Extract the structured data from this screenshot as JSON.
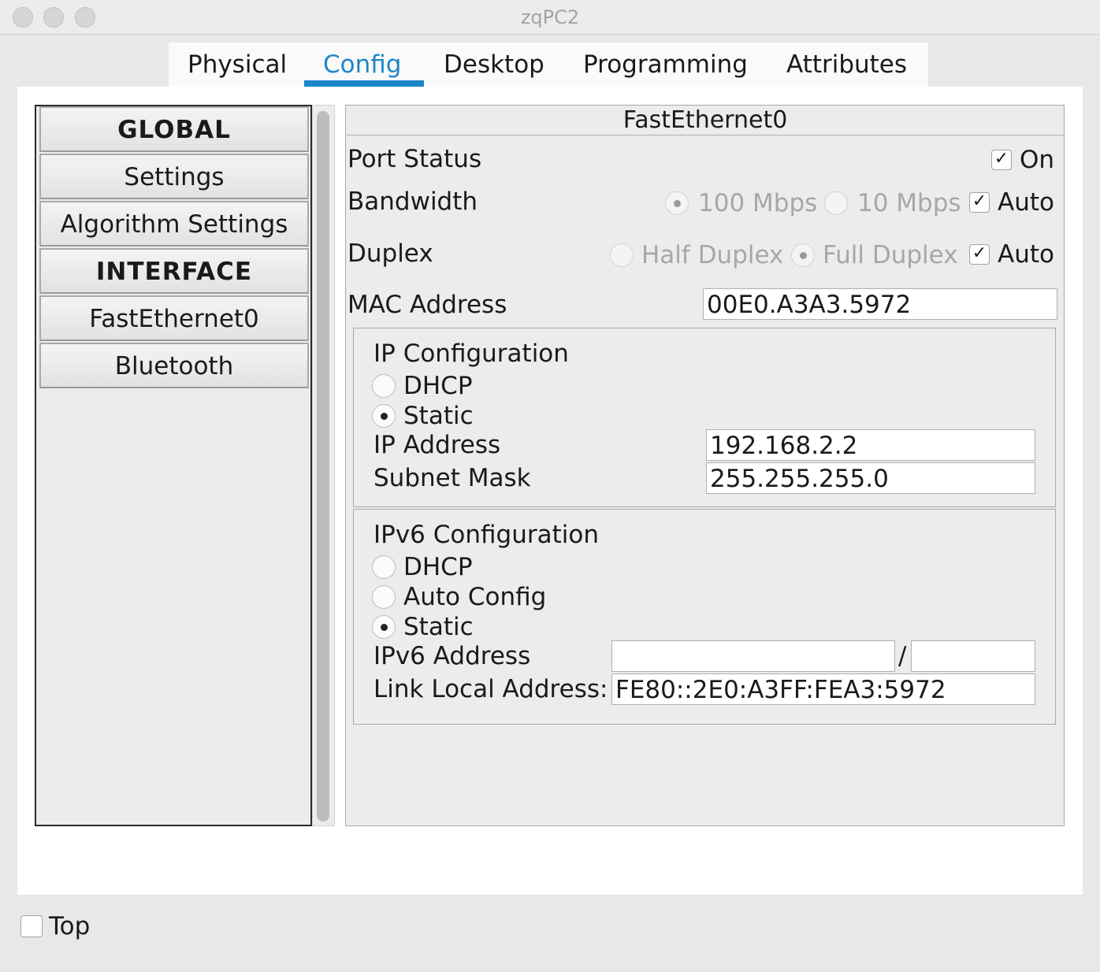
{
  "window": {
    "title": "zqPC2"
  },
  "tabs": [
    "Physical",
    "Config",
    "Desktop",
    "Programming",
    "Attributes"
  ],
  "active_tab": "Config",
  "sidebar": {
    "items": [
      {
        "label": "GLOBAL",
        "type": "header"
      },
      {
        "label": "Settings",
        "type": "item"
      },
      {
        "label": "Algorithm Settings",
        "type": "item"
      },
      {
        "label": "INTERFACE",
        "type": "header"
      },
      {
        "label": "FastEthernet0",
        "type": "item"
      },
      {
        "label": "Bluetooth",
        "type": "item"
      }
    ]
  },
  "panel": {
    "title": "FastEthernet0",
    "port_status": {
      "label": "Port Status",
      "on_label": "On",
      "checked": true
    },
    "bandwidth": {
      "label": "Bandwidth",
      "opt_100": "100 Mbps",
      "opt_10": "10 Mbps",
      "auto_label": "Auto",
      "selected": "100 Mbps",
      "auto": true
    },
    "duplex": {
      "label": "Duplex",
      "opt_half": "Half Duplex",
      "opt_full": "Full Duplex",
      "auto_label": "Auto",
      "selected": "Full Duplex",
      "auto": true
    },
    "mac": {
      "label": "MAC Address",
      "value": "00E0.A3A3.5972"
    },
    "ip_config": {
      "title": "IP Configuration",
      "dhcp_label": "DHCP",
      "static_label": "Static",
      "selected": "Static",
      "ip_label": "IP Address",
      "ip_value": "192.168.2.2",
      "mask_label": "Subnet Mask",
      "mask_value": "255.255.255.0"
    },
    "ipv6_config": {
      "title": "IPv6 Configuration",
      "dhcp_label": "DHCP",
      "auto_label": "Auto Config",
      "static_label": "Static",
      "selected": "Static",
      "addr_label": "IPv6 Address",
      "addr_value": "",
      "prefix_sep": "/",
      "prefix_value": "",
      "link_local_label": "Link Local Address:",
      "link_local_value": "FE80::2E0:A3FF:FEA3:5972"
    }
  },
  "footer": {
    "top_label": "Top",
    "top_checked": false
  },
  "colors": {
    "accent": "#1a86c8",
    "disabled_text": "#a7a7a7",
    "panel_bg": "#ececec"
  },
  "icons": {
    "checkmark": "✓"
  }
}
